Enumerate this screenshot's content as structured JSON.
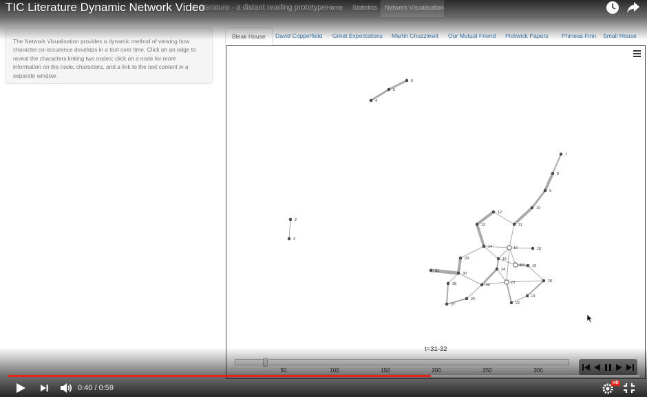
{
  "video": {
    "title": "TIC Literature Dynamic Network Video",
    "current_time": "0:40",
    "duration": "0:59",
    "time_separator": " / ",
    "progress_played": 0.67,
    "progress_buffered": 0.67
  },
  "site": {
    "brand": "sh literature - a distant reading prototype",
    "nav": [
      "Home",
      "Statistics",
      "Network Visualisation"
    ],
    "active_nav": "Network Visualisation"
  },
  "info": {
    "text": "The Network Visualisation provides a dynamic method of viewing how character co-occurence develops in a text over time. Click on an edge to reveal the characters linking two nodes; click on a node for more information on the node, characters, and a link to the text content in a separate window."
  },
  "tabs": [
    "Bleak House",
    "David Copperfield",
    "Great Expectations",
    "Martin Chuzzlewit",
    "Our Mutual Friend",
    "Pickwick Papers",
    "Phineas Finn",
    "Small House"
  ],
  "active_tab": "Bleak House",
  "network": {
    "time_label": "t=31-32",
    "slider_value": 32,
    "slider_ticks": [
      "50",
      "100",
      "150",
      "200",
      "250",
      "300"
    ]
  },
  "icons": {
    "watch_later": "clock-icon",
    "share": "share-icon",
    "play": "play-icon",
    "next": "next-icon",
    "volume": "volume-icon",
    "settings": "gear-icon",
    "fullscreen_exit": "exit-fullscreen-icon",
    "menu": "hamburger-icon"
  },
  "colors": {
    "progress": "#e62117",
    "tab_link": "#337ab7"
  },
  "hd_badge": "HD"
}
